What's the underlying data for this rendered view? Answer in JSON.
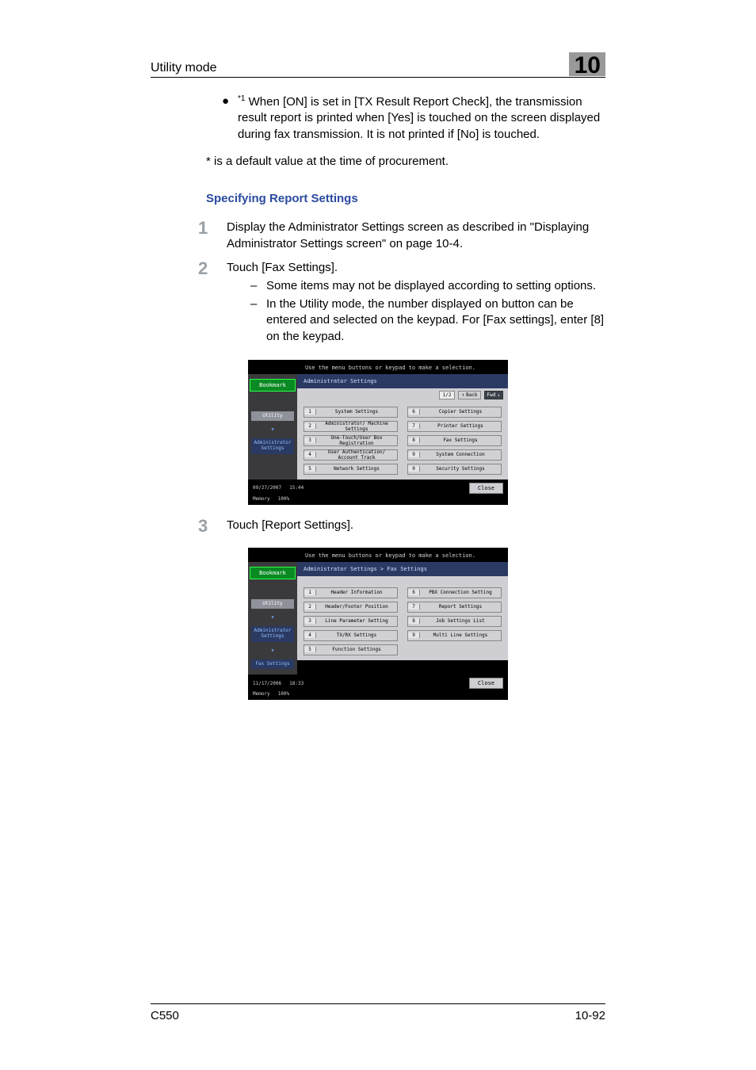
{
  "header": {
    "title": "Utility mode",
    "chapter": "10"
  },
  "body": {
    "bullet1_sup": "*1",
    "bullet1": " When [ON] is set in [TX Result Report Check], the transmission result report is printed when [Yes] is touched on the screen displayed during fax transmission. It is not printed if [No] is touched.",
    "note": "* is a default value at the time of procurement.",
    "heading": "Specifying Report Settings",
    "step1": "Display the Administrator Settings screen as described in \"Displaying Administrator Settings screen\" on page 10-4.",
    "step2": "Touch [Fax Settings].",
    "step2_dash1": "Some items may not be displayed according to setting options.",
    "step2_dash2": "In the Utility mode, the number displayed on button can be entered and selected on the keypad. For [Fax settings], enter [8] on the keypad.",
    "step3": "Touch [Report Settings]."
  },
  "screenshot1": {
    "instruction": "Use the menu buttons or keypad to make a selection.",
    "bookmark": "Bookmark",
    "side": {
      "utility": "Utility",
      "admin": "Administrator Settings"
    },
    "breadcrumb": "Administrator Settings",
    "pager": "1/2",
    "back": "Back",
    "fwd": "Fwd",
    "buttons_left": [
      {
        "n": "1",
        "l": "System Settings"
      },
      {
        "n": "2",
        "l": "Administrator/ Machine Settings"
      },
      {
        "n": "3",
        "l": "One-Touch/User Box Registration"
      },
      {
        "n": "4",
        "l": "User Authentication/ Account Track"
      },
      {
        "n": "5",
        "l": "Network Settings"
      }
    ],
    "buttons_right": [
      {
        "n": "6",
        "l": "Copier Settings"
      },
      {
        "n": "7",
        "l": "Printer Settings"
      },
      {
        "n": "8",
        "l": "Fax Settings"
      },
      {
        "n": "9",
        "l": "System Connection"
      },
      {
        "n": "0",
        "l": "Security Settings"
      }
    ],
    "footer": {
      "date": "09/27/2007",
      "time": "15:44",
      "mem_label": "Memory",
      "mem": "100%",
      "close": "Close"
    }
  },
  "screenshot2": {
    "instruction": "Use the menu buttons or keypad to make a selection.",
    "bookmark": "Bookmark",
    "side": {
      "utility": "Utility",
      "admin": "Administrator Settings",
      "fax": "Fax Settings"
    },
    "breadcrumb": "Administrator Settings  > Fax Settings",
    "buttons_left": [
      {
        "n": "1",
        "l": "Header Information"
      },
      {
        "n": "2",
        "l": "Header/Footer Position"
      },
      {
        "n": "3",
        "l": "Line Parameter Setting"
      },
      {
        "n": "4",
        "l": "TX/RX Settings"
      },
      {
        "n": "5",
        "l": "Function Settings"
      }
    ],
    "buttons_right": [
      {
        "n": "6",
        "l": "PBX Connection Setting"
      },
      {
        "n": "7",
        "l": "Report Settings"
      },
      {
        "n": "8",
        "l": "Job Settings List"
      },
      {
        "n": "9",
        "l": "Multi Line Settings"
      }
    ],
    "footer": {
      "date": "11/17/2006",
      "time": "18:33",
      "mem_label": "Memory",
      "mem": "100%",
      "close": "Close"
    }
  },
  "footer": {
    "model": "C550",
    "pageno": "10-92"
  }
}
